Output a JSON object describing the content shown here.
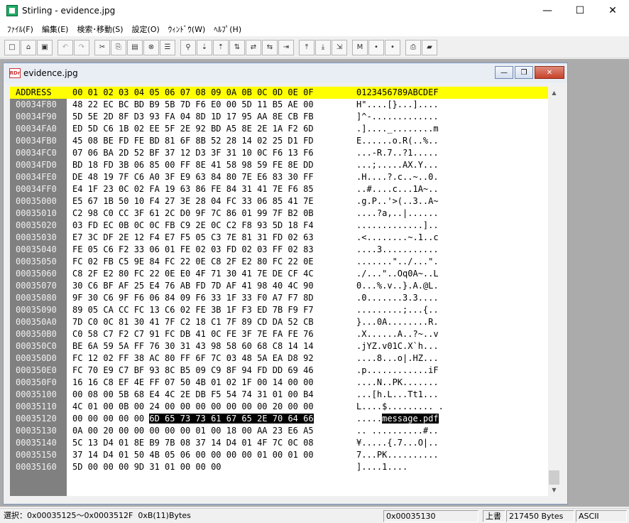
{
  "window": {
    "title": "Stirling - evidence.jpg",
    "minimize": "—",
    "maximize": "☐",
    "close": "✕"
  },
  "menu": [
    "ﾌｧｲﾙ(F)",
    "編集(E)",
    "検索･移動(S)",
    "設定(O)",
    "ｳｨﾝﾄﾞｳ(W)",
    "ﾍﾙﾌﾟ(H)"
  ],
  "toolbar": {
    "icons": [
      "new-file-icon",
      "open-folder-icon",
      "save-icon",
      "|",
      "undo-icon",
      "redo-icon",
      "|",
      "cut-icon",
      "copy-icon",
      "paste-icon",
      "delete-icon",
      "list-icon",
      "|",
      "binoculars-icon",
      "find-next-icon",
      "find-prev-icon",
      "find-up-icon",
      "replace-icon",
      "compare-icon",
      "goto-icon",
      "|",
      "jump-top-icon",
      "jump-bottom-icon",
      "jump-address-icon",
      "|",
      "mark-icon",
      "mark-next-icon",
      "mark-prev-icon",
      "|",
      "print-icon",
      "book-icon"
    ],
    "glyphs": [
      "□",
      "⌂",
      "▣",
      "|",
      "↶",
      "↷",
      "|",
      "✂",
      "⎘",
      "▤",
      "⊗",
      "☰",
      "|",
      "⚲",
      "⇣",
      "⇡",
      "⇅",
      "⇄",
      "⇆",
      "⇥",
      "|",
      "⤒",
      "⤓",
      "⇲",
      "|",
      "M",
      "•",
      "•",
      "|",
      "⎙",
      "▰"
    ]
  },
  "child": {
    "icon_text": "RDr",
    "title": "evidence.jpg",
    "minimize": "—",
    "restore": "❐",
    "close": "✕"
  },
  "hex": {
    "header": {
      "address": "ADDRESS",
      "hex": "00 01 02 03 04 05 06 07 08 09 0A 0B 0C 0D 0E 0F",
      "ascii": "0123456789ABCDEF"
    },
    "rows": [
      {
        "addr": "00034F80",
        "hex": "48 22 EC BC BD B9 5B 7D F6 E0 00 5D 11 B5 AE 00",
        "ascii": "H\"....[}...]...."
      },
      {
        "addr": "00034F90",
        "hex": "5D 5E 2D 8F D3 93 FA 04 8D 1D 17 95 AA 8E CB FB",
        "ascii": "]^-............."
      },
      {
        "addr": "00034FA0",
        "hex": "ED 5D C6 1B 02 EE 5F 2E 92 BD A5 8E 2E 1A F2 6D",
        "ascii": ".]...._........m"
      },
      {
        "addr": "00034FB0",
        "hex": "45 08 BE FD FE BD 81 6F 8B 52 28 14 02 25 D1 FD",
        "ascii": "E......o.R(..%.."
      },
      {
        "addr": "00034FC0",
        "hex": "07 06 BA 2D 52 BF 37 12 D3 3F 31 10 0C F6 13 F6",
        "ascii": "...-R.7..?1....."
      },
      {
        "addr": "00034FD0",
        "hex": "BD 18 FD 3B 06 85 00 FF 8E 41 58 98 59 FE 8E DD",
        "ascii": "...;.....AX.Y..."
      },
      {
        "addr": "00034FE0",
        "hex": "DE 48 19 7F C6 A0 3F E9 63 84 80 7E E6 83 30 FF",
        "ascii": ".H....?.c..~..0."
      },
      {
        "addr": "00034FF0",
        "hex": "E4 1F 23 0C 02 FA 19 63 86 FE 84 31 41 7E F6 85",
        "ascii": "..#....c...1A~.."
      },
      {
        "addr": "00035000",
        "hex": "E5 67 1B 50 10 F4 27 3E 28 04 FC 33 06 85 41 7E",
        "ascii": ".g.P..'>(..3..A~"
      },
      {
        "addr": "00035010",
        "hex": "C2 98 C0 CC 3F 61 2C D0 9F 7C 86 01 99 7F B2 0B",
        "ascii": "....?a,..|......"
      },
      {
        "addr": "00035020",
        "hex": "03 FD EC 0B 0C 0C FB C9 2E 0C C2 F8 93 5D 18 F4",
        "ascii": ".............].."
      },
      {
        "addr": "00035030",
        "hex": "E7 3C DF 2E 12 F4 E7 F5 05 C3 7E 81 31 FD 02 63",
        "ascii": ".<........~.1..c"
      },
      {
        "addr": "00035040",
        "hex": "FE 05 C6 F2 33 06 01 FE 02 03 FD 02 03 FF 02 83",
        "ascii": "....3..........."
      },
      {
        "addr": "00035050",
        "hex": "FC 02 FB C5 9E 84 FC 22 0E C8 2F E2 80 FC 22 0E",
        "ascii": ".......\"../...\"."
      },
      {
        "addr": "00035060",
        "hex": "C8 2F E2 80 FC 22 0E E0 4F 71 30 41 7E DE CF 4C",
        "ascii": "./...\"..Oq0A~..L"
      },
      {
        "addr": "00035070",
        "hex": "30 C6 BF AF 25 E4 76 AB FD 7D AF 41 98 40 4C 90",
        "ascii": "0...%.v..}.A.@L."
      },
      {
        "addr": "00035080",
        "hex": "9F 30 C6 9F F6 06 84 09 F6 33 1F 33 F0 A7 F7 8D",
        "ascii": ".0.......3.3...."
      },
      {
        "addr": "00035090",
        "hex": "89 05 CA CC FC 13 C6 02 FE 3B 1F F3 ED 7B F9 F7",
        "ascii": ".........;...{.."
      },
      {
        "addr": "000350A0",
        "hex": "7D C0 0C 81 30 41 7F C2 18 C1 7F 89 CD DA 52 CB",
        "ascii": "}...0A........R."
      },
      {
        "addr": "000350B0",
        "hex": "C0 58 C7 F2 C7 91 FC DB 41 0C FE 3F 7E FA FE 76",
        "ascii": ".X......A..?~..v"
      },
      {
        "addr": "000350C0",
        "hex": "BE 6A 59 5A FF 76 30 31 43 98 58 60 68 C8 14 14",
        "ascii": ".jYZ.v01C.X`h..."
      },
      {
        "addr": "000350D0",
        "hex": "FC 12 02 FF 38 AC 80 FF 6F 7C 03 48 5A EA D8 92",
        "ascii": "....8...o|.HZ..."
      },
      {
        "addr": "000350E0",
        "hex": "FC 70 E9 C7 BF 93 8C B5 09 C9 8F 94 FD DD 69 46",
        "ascii": ".p............iF"
      },
      {
        "addr": "000350F0",
        "hex": "16 16 C8 EF 4E FF 07 50 4B 01 02 1F 00 14 00 00",
        "ascii": "....N..PK......."
      },
      {
        "addr": "00035100",
        "hex": "00 08 00 5B 68 E4 4C 2E DB F5 54 74 31 01 00 B4",
        "ascii": "...[h.L...Tt1..."
      },
      {
        "addr": "00035110",
        "hex": "4C 01 00 0B 00 24 00 00 00 00 00 00 00 20 00 00",
        "ascii": "L....$......... ."
      },
      {
        "addr": "00035120",
        "hex_plain": "00 00 00 00 00 ",
        "hex_sel": "6D 65 73 73 61 67 65 2E 70 64 66",
        "ascii_plain": ".....",
        "ascii_sel": "message.pdf"
      },
      {
        "addr": "00035130",
        "hex": "0A 00 20 00 00 00 00 00 01 00 18 00 AA 23 E6 A5",
        "ascii": ".. ..........#.."
      },
      {
        "addr": "00035140",
        "hex": "5C 13 D4 01 8E B9 7B 08 37 14 D4 01 4F 7C 0C 08",
        "ascii": "¥.....{.7...O|.."
      },
      {
        "addr": "00035150",
        "hex": "37 14 D4 01 50 4B 05 06 00 00 00 00 01 00 01 00",
        "ascii": "7...PK.........."
      },
      {
        "addr": "00035160",
        "hex": "5D 00 00 00 9D 31 01 00 00 00",
        "ascii": "]....1...."
      }
    ]
  },
  "scrollbar": {
    "up": "▲",
    "down": "▼"
  },
  "status": {
    "selection": "選択：0x00035125〜0x0003512F  0xB(11)Bytes",
    "cursor": "0x00035130",
    "mode": "上書",
    "size": "217450 Bytes",
    "encoding": "ASCII"
  }
}
